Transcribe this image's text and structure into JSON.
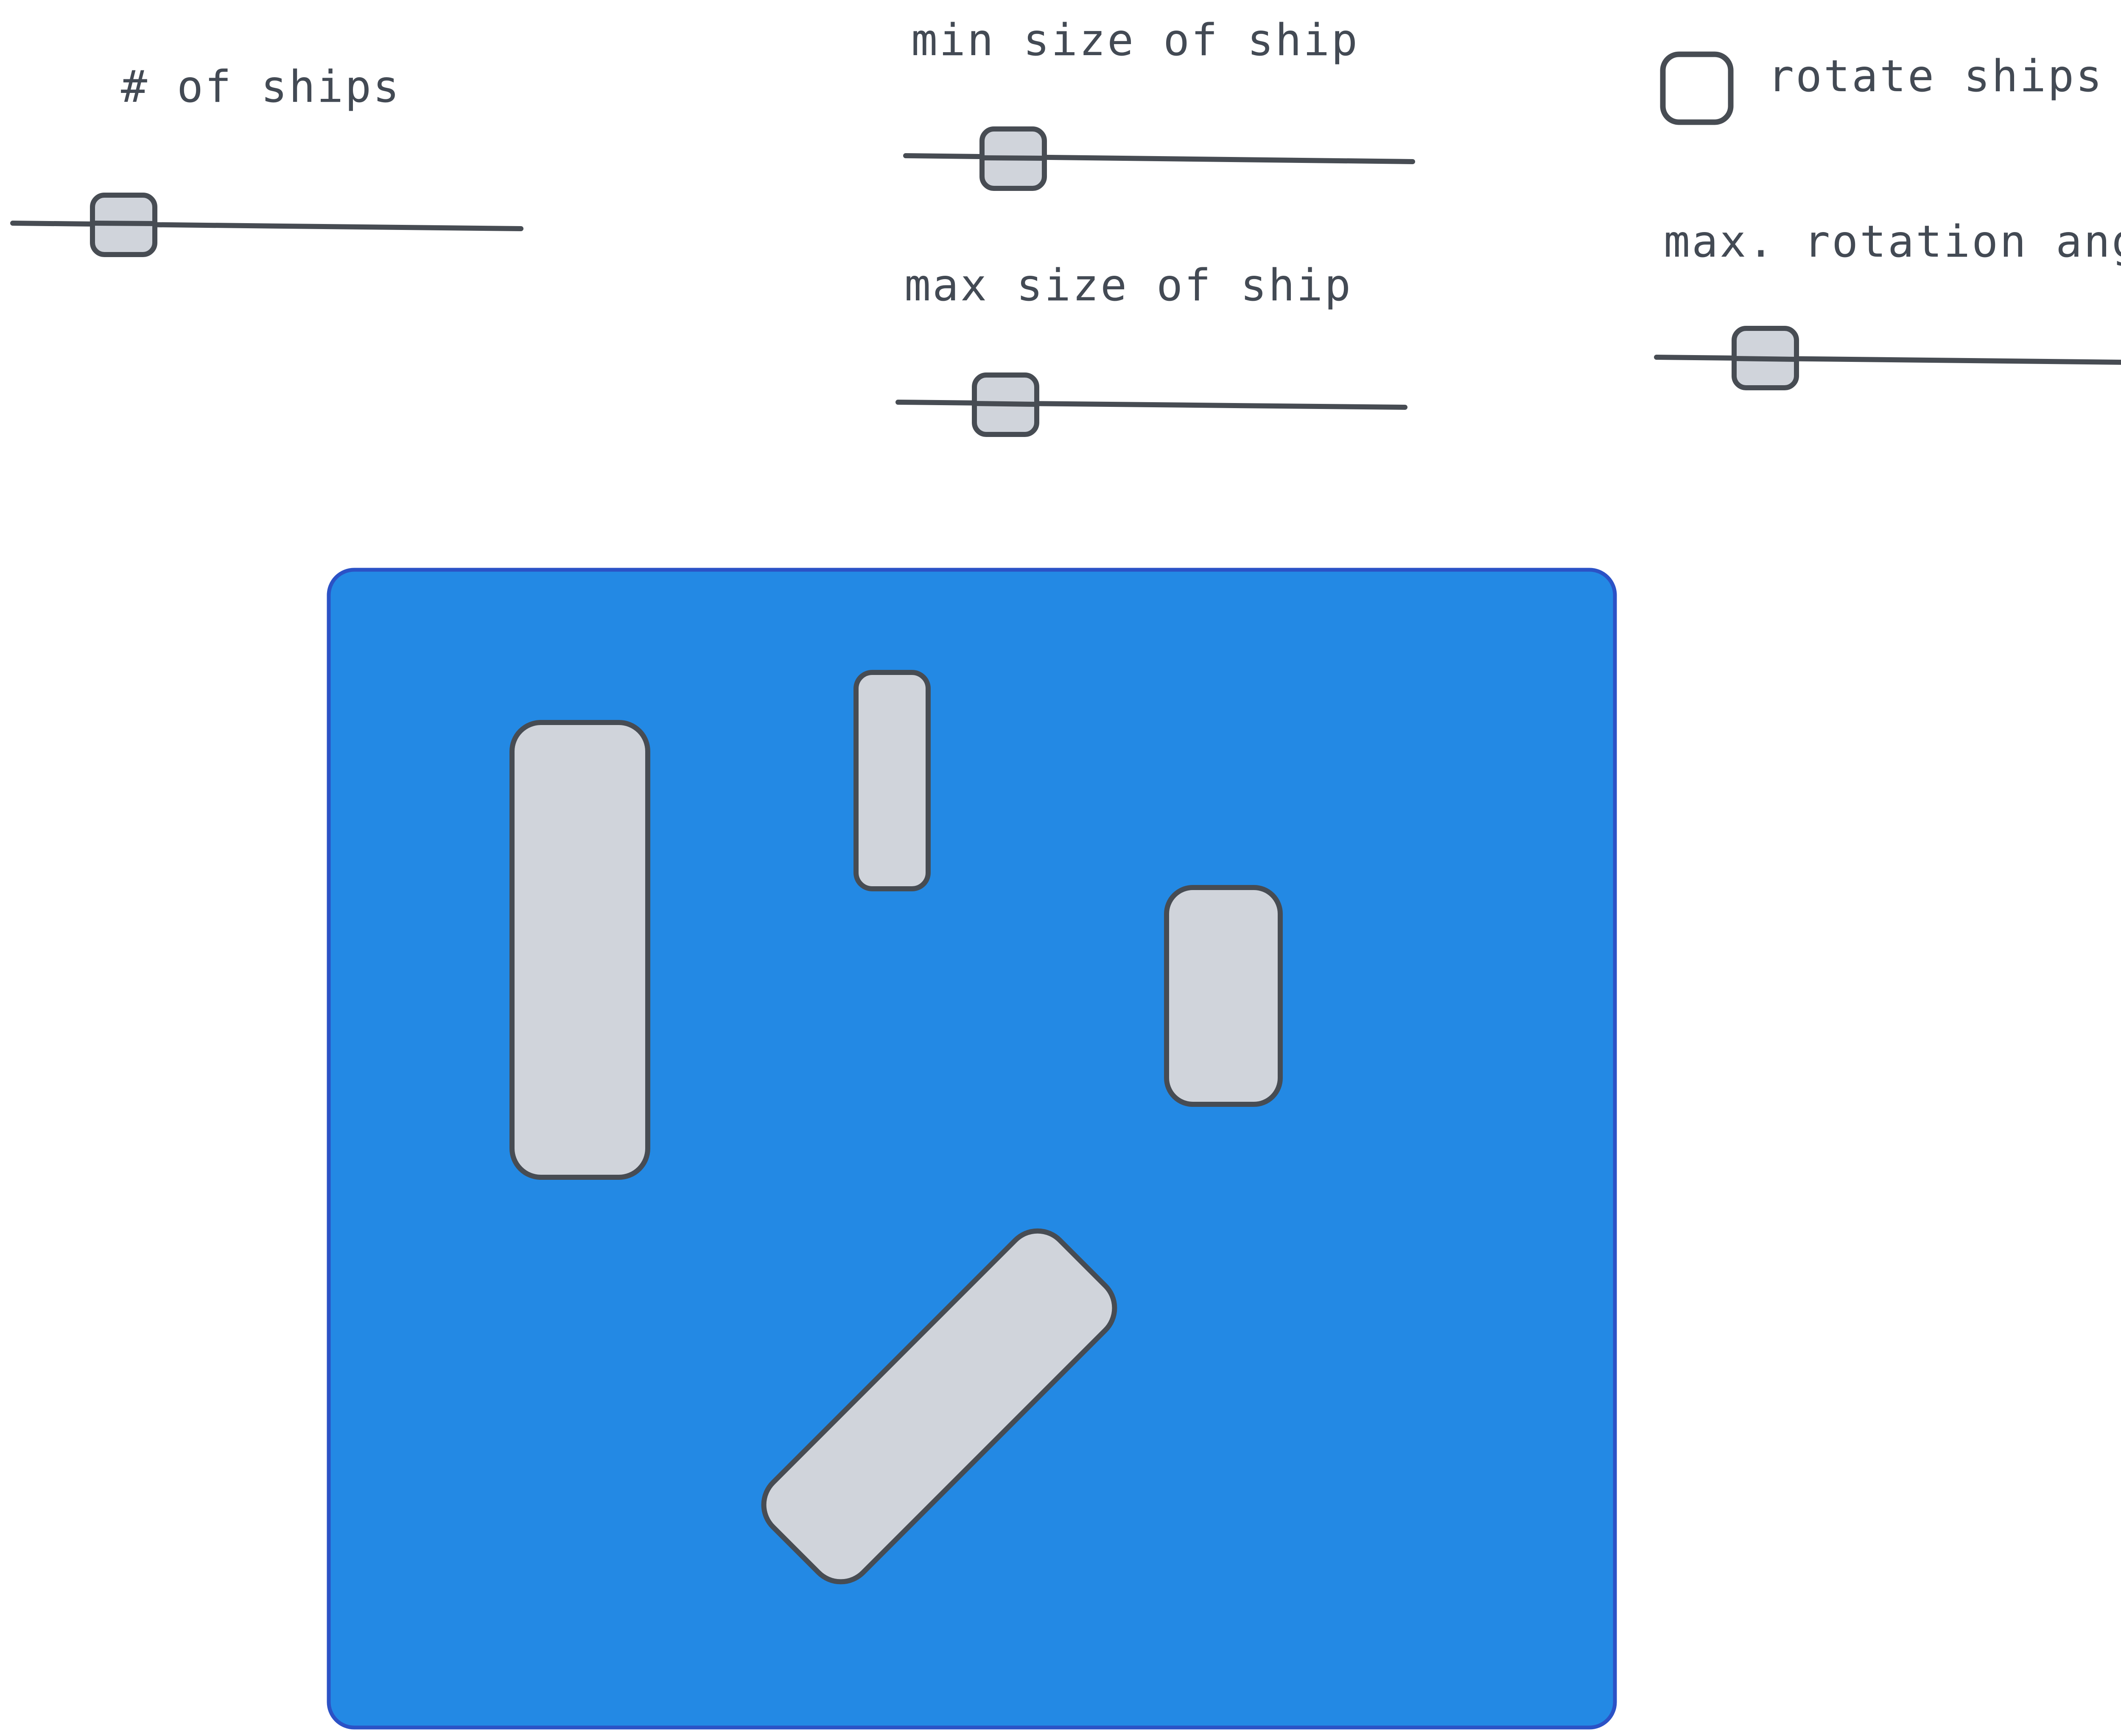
{
  "controls": {
    "num_ships": {
      "label": "# of ships",
      "value": 0.16
    },
    "min_size": {
      "label": "min size of ship",
      "value": 0.21
    },
    "max_size": {
      "label": "max size of ship",
      "value": 0.22
    },
    "rotate_ships": {
      "label": "rotate ships",
      "checked": false
    },
    "max_rotation_angle": {
      "label": "max. rotation angle",
      "value": 0.22
    }
  },
  "ocean": {
    "color": "#2389e4",
    "border_color": "#2b52c6"
  },
  "ships": [
    {
      "name": "ship-1",
      "orientation": "vertical"
    },
    {
      "name": "ship-2",
      "orientation": "vertical"
    },
    {
      "name": "ship-3",
      "orientation": "vertical"
    },
    {
      "name": "ship-4",
      "orientation": "rotated",
      "angle_deg": 45
    }
  ],
  "colors": {
    "ink": "#474c53",
    "ship_fill": "#d0d4db",
    "text": "#434a54"
  }
}
